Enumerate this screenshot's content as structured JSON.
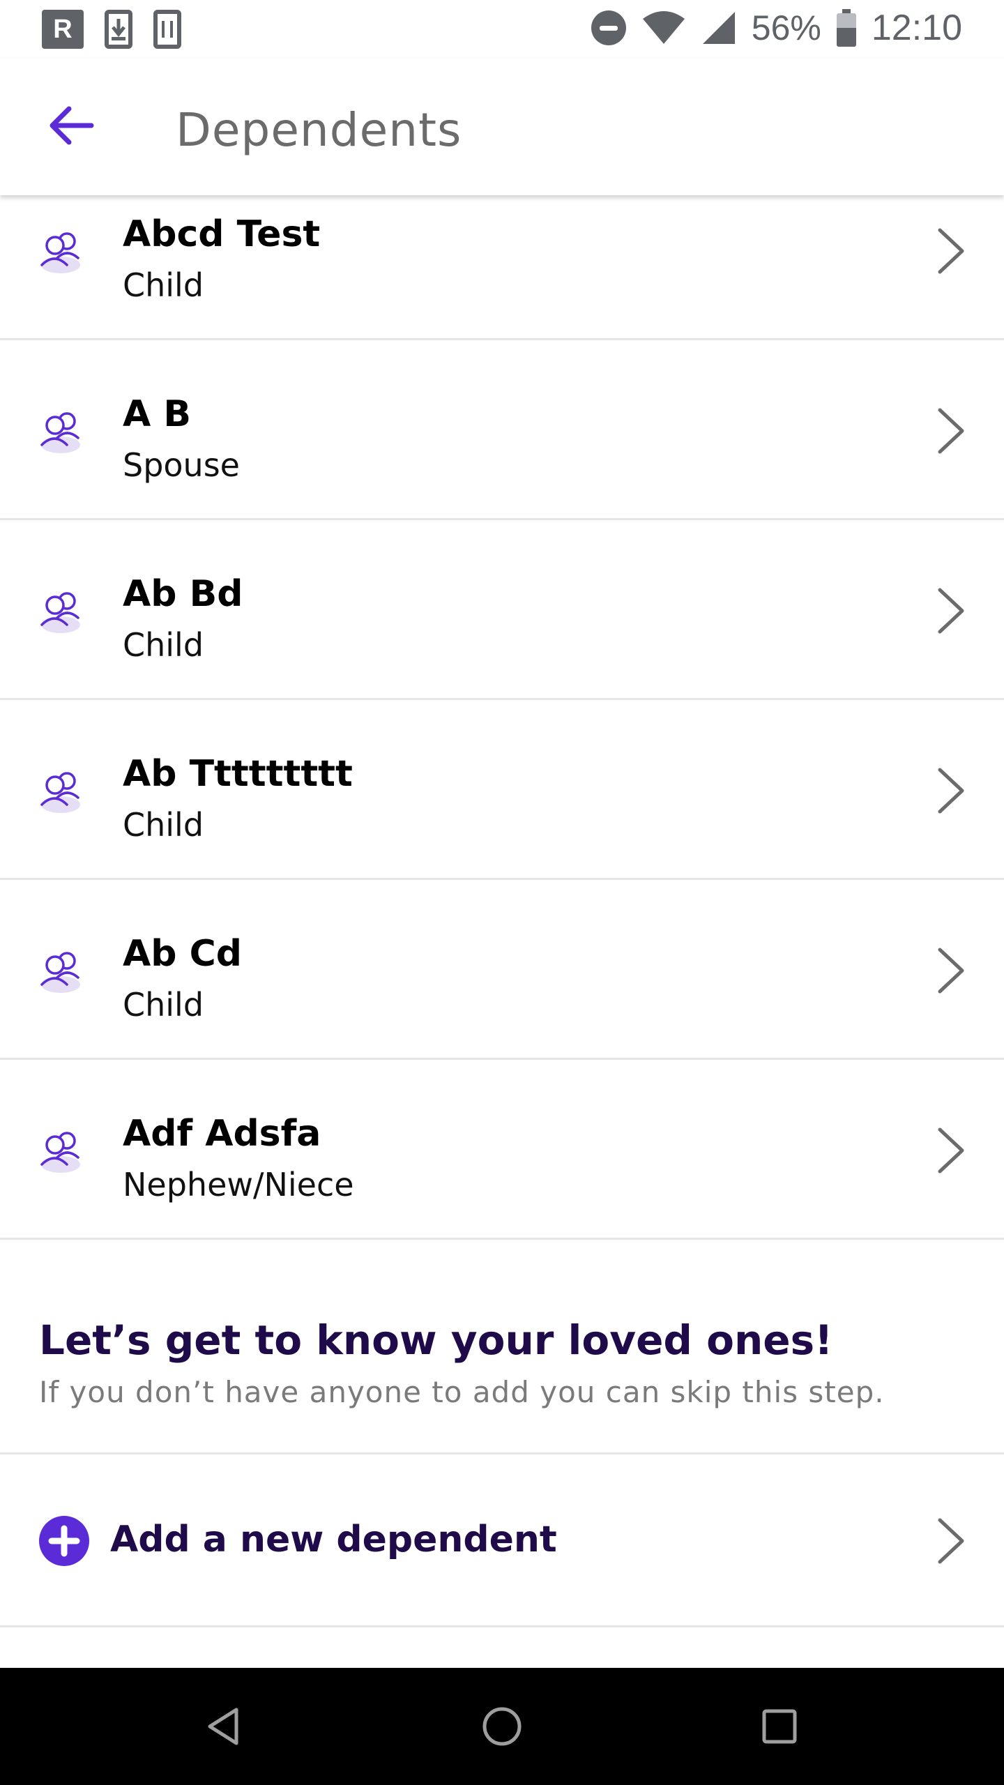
{
  "status_bar": {
    "left_icons": [
      "r-icon",
      "download-icon",
      "phone-icon"
    ],
    "r_label": "R",
    "battery_percent": "56%",
    "battery_level": 0.56,
    "time": "12:10"
  },
  "app_bar": {
    "title": "Dependents",
    "back_icon": "arrow-left-icon"
  },
  "dependents": [
    {
      "name": "Abcd Test",
      "relation": "Child"
    },
    {
      "name": "A B",
      "relation": "Spouse"
    },
    {
      "name": "Ab Bd",
      "relation": "Child"
    },
    {
      "name": "Ab Ttttttttt",
      "relation": "Child"
    },
    {
      "name": "Ab Cd",
      "relation": "Child"
    },
    {
      "name": "Adf Adsfa",
      "relation": "Nephew/Niece"
    }
  ],
  "intro": {
    "heading": "Let’s get to know your loved ones!",
    "subtext": "If you don’t have anyone to add you can skip this step."
  },
  "add_dependent": {
    "label": "Add a new dependent",
    "icon": "plus-circle-icon"
  },
  "nav_bar": {
    "buttons": [
      "back-triangle-icon",
      "home-circle-icon",
      "recents-square-icon"
    ]
  },
  "colors": {
    "accent": "#5a2bd6",
    "heading": "#1f0a4a",
    "icon_fill": "#e6def5",
    "chevron": "#6b6b6b",
    "divider": "#e6e6e6"
  }
}
